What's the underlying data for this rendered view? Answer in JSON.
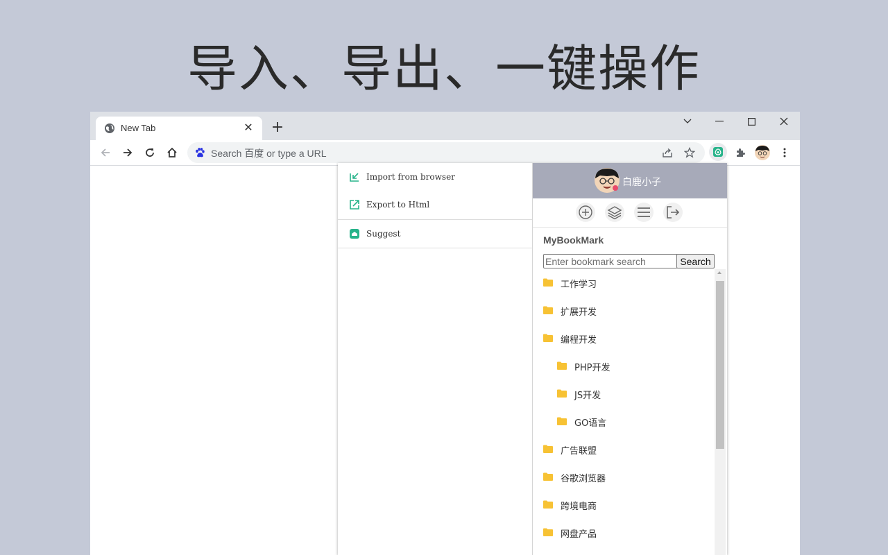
{
  "headline": "导入、导出、一键操作",
  "browser": {
    "tab": {
      "title": "New Tab"
    },
    "omnibox": {
      "text": "Search 百度 or type a URL"
    }
  },
  "menu": {
    "items": [
      {
        "label": "Import from browser",
        "icon": "import-icon"
      },
      {
        "label": "Export to Html",
        "icon": "export-icon"
      },
      {
        "label": "Suggest",
        "icon": "suggest-icon"
      }
    ]
  },
  "sidebar": {
    "username": "白鹿小子",
    "actions": [
      "add-circle-icon",
      "layers-icon",
      "menu-lines-icon",
      "logout-icon"
    ],
    "title": "MyBookMark",
    "search_placeholder": "Enter bookmark search",
    "search_button": "Search",
    "folders": [
      {
        "label": "工作学习"
      },
      {
        "label": "扩展开发"
      },
      {
        "label": "编程开发"
      },
      {
        "label": "PHP开发"
      },
      {
        "label": "JS开发"
      },
      {
        "label": "GO语言"
      },
      {
        "label": "广告联盟"
      },
      {
        "label": "谷歌浏览器"
      },
      {
        "label": "跨境电商"
      },
      {
        "label": "网盘产品"
      }
    ]
  },
  "colors": {
    "background": "#c4c9d7",
    "header": "#a7aab9",
    "folder": "#f7c234",
    "accent": "#27b38a"
  }
}
